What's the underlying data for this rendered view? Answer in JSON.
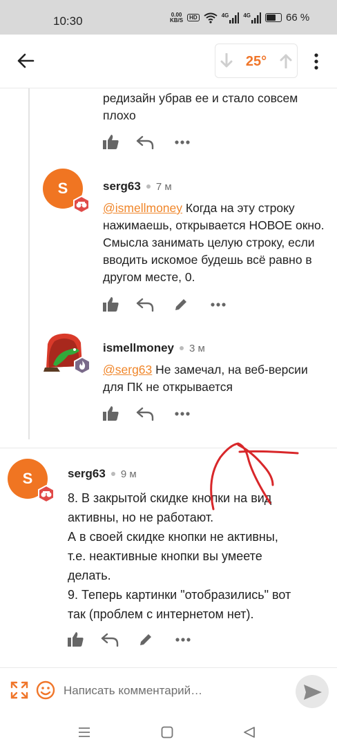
{
  "status_bar": {
    "time": "10:30",
    "net_speed_value": "0.00",
    "net_speed_unit": "KB/S",
    "hd_label": "HD",
    "signal1_label": "4G",
    "signal2_label": "4G",
    "battery_percent": "66 %"
  },
  "app_bar": {
    "rating": "25°",
    "icons": [
      "arrow-left-icon",
      "arrow-down-icon",
      "arrow-up-icon",
      "more-vertical-icon"
    ]
  },
  "comments": [
    {
      "text": "редизайн убрав ее и стало совсем плохо"
    },
    {
      "author": "serg63",
      "avatar_letter": "S",
      "time": "7 м",
      "mention": "@ismellmoney",
      "text": " Когда на эту строку нажимаешь, открывается НОВОЕ окно. Смысла занимать целую строку, если вводить искомое будешь всё равно в другом месте, 0."
    },
    {
      "author": "ismellmoney",
      "time": "3 м",
      "mention": "@serg63",
      "text": " Не замечал, на веб-версии для ПК не открывается"
    },
    {
      "author": "serg63",
      "avatar_letter": "S",
      "time": "9 м",
      "lines": [
        "8. В закрытой скидке кнопки на вид",
        "активны, но не работают.",
        "А в своей скидке кнопки не активны,",
        "т.е. неактивные кнопки вы умеете",
        "делать.",
        "9. Теперь картинки \"отобразились\" вот",
        "так (проблем с интернетом нет)."
      ]
    }
  ],
  "input": {
    "placeholder": "Написать комментарий…"
  },
  "colors": {
    "accent": "#f0762a",
    "avatar": "#f07522",
    "badge_red": "#e04a48",
    "badge_purple": "#7a6a8a",
    "scribble": "#d8272a"
  }
}
